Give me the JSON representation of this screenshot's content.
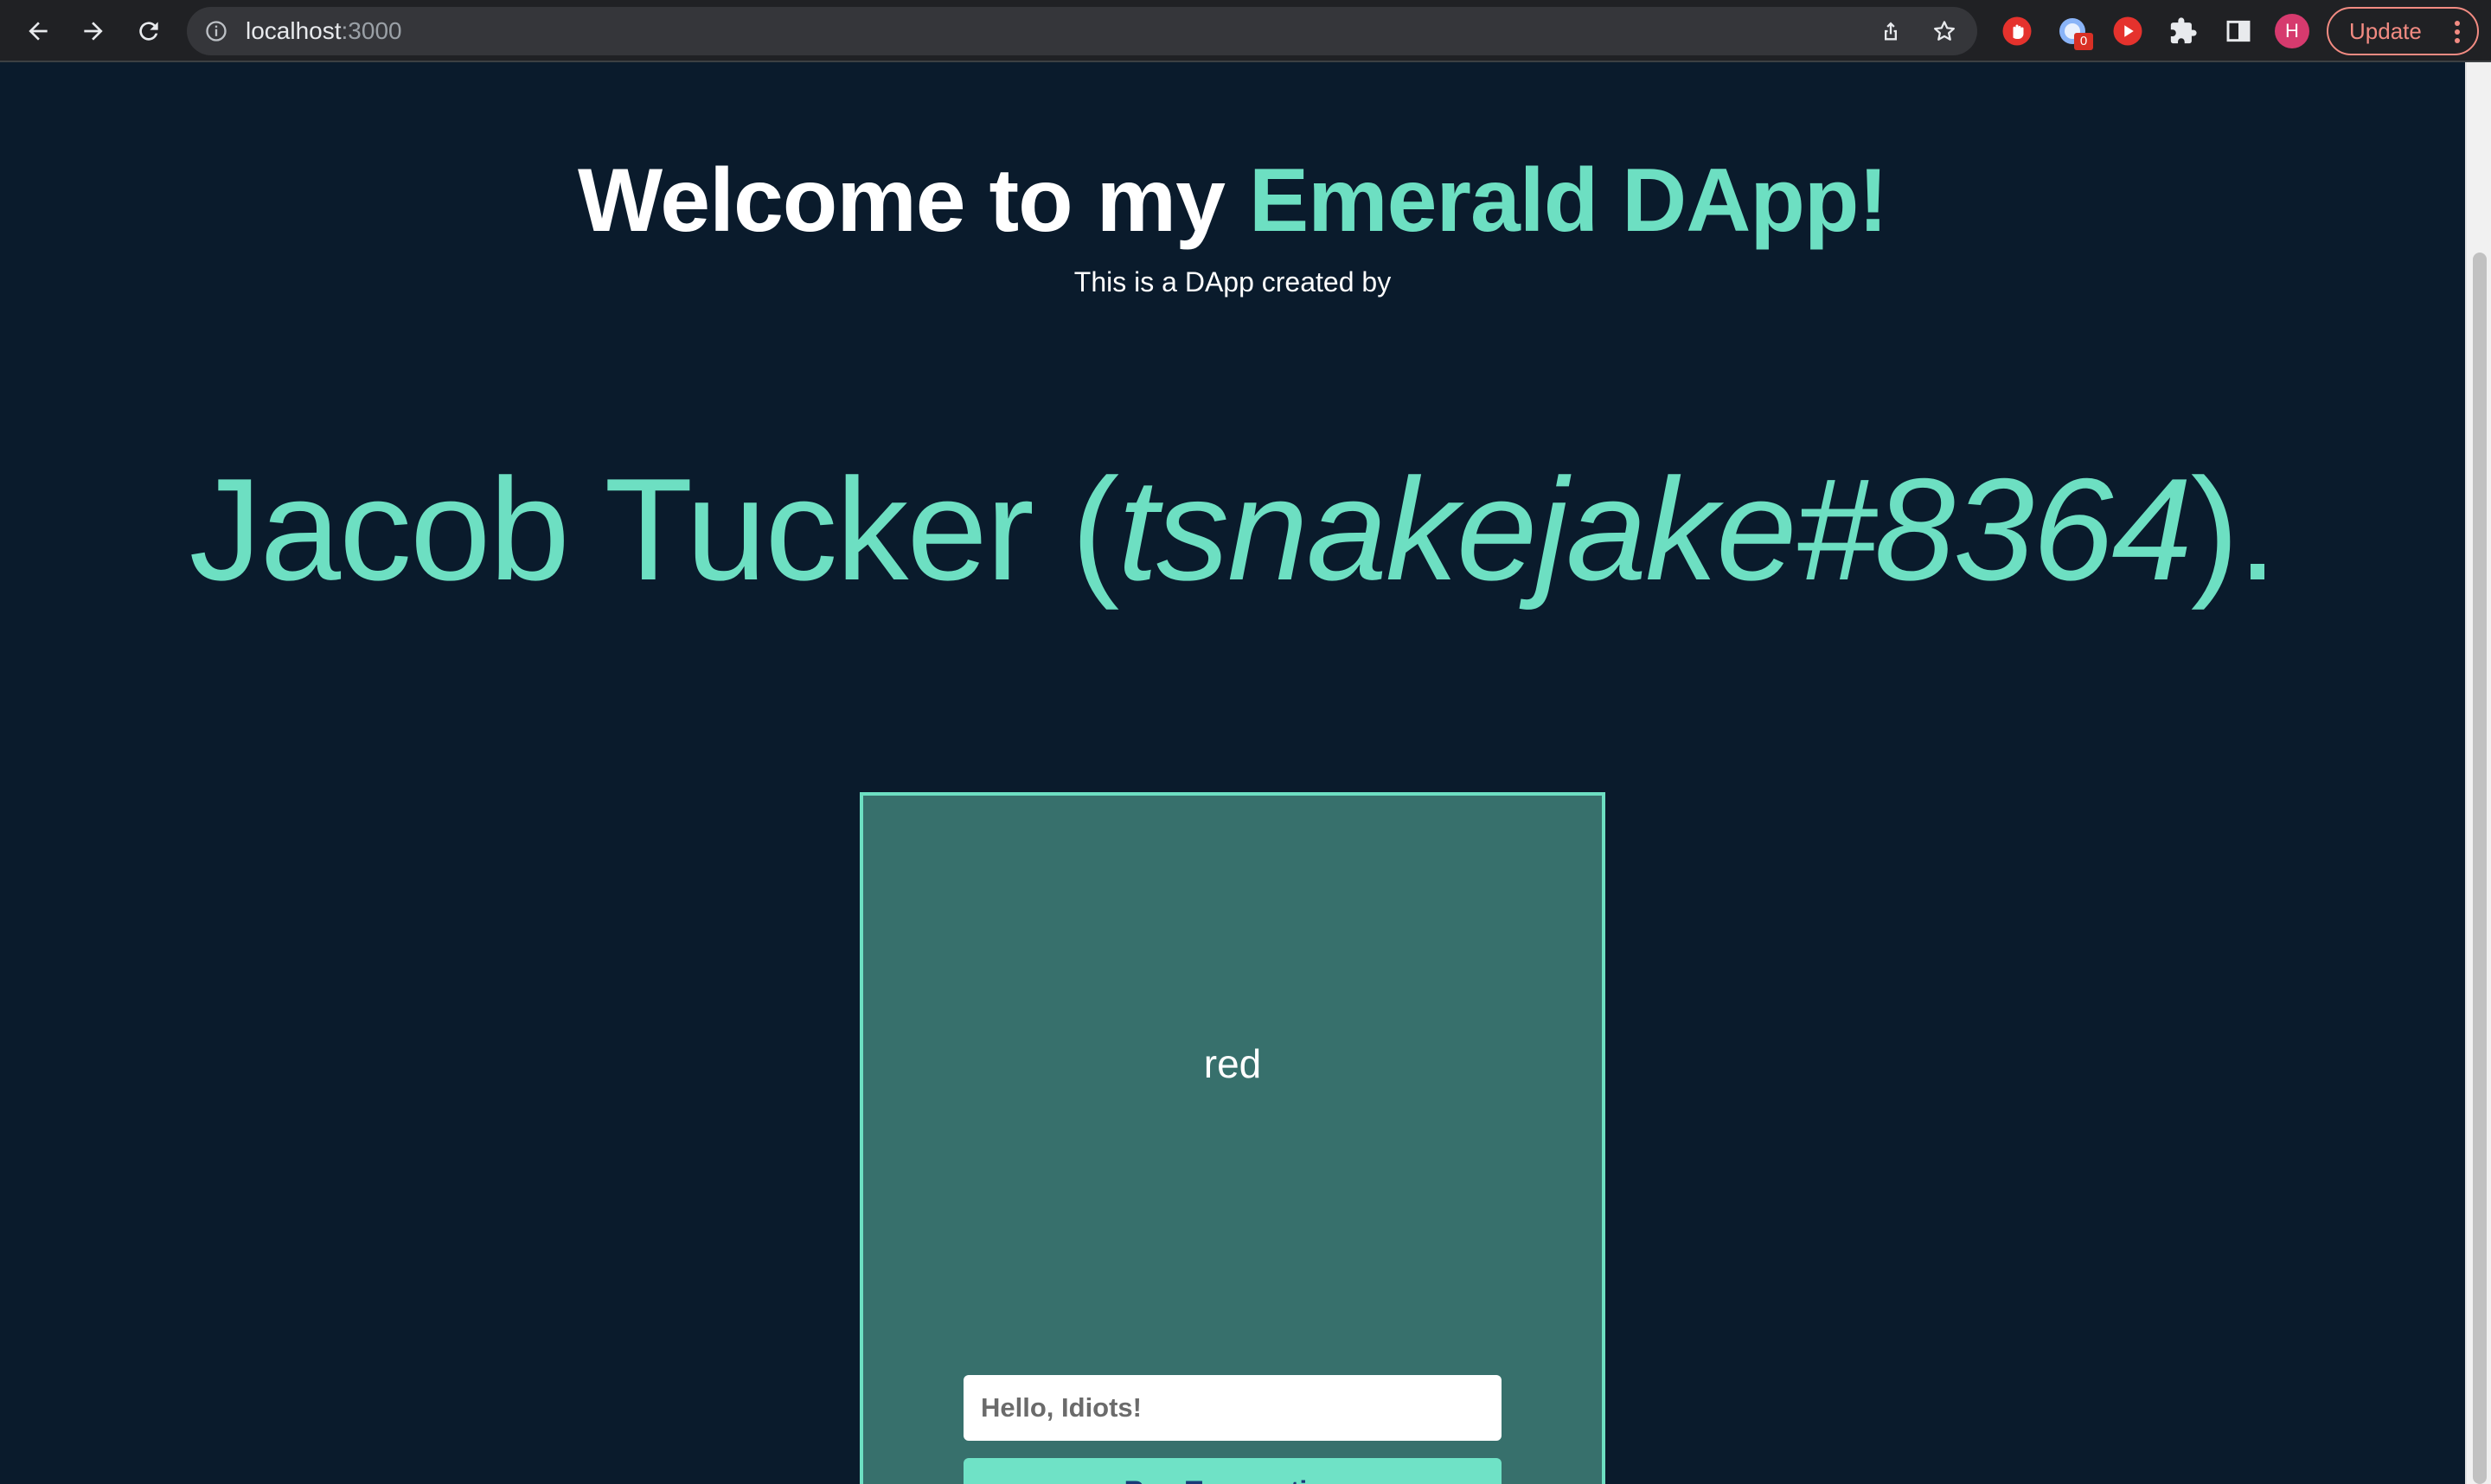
{
  "browser": {
    "url_host": "localhost",
    "url_port": ":3000",
    "update_label": "Update",
    "profile_initial": "H",
    "extension_badge": "0",
    "icons": [
      "back-arrow-icon",
      "forward-arrow-icon",
      "reload-icon",
      "info-icon",
      "share-icon",
      "bookmark-star-icon",
      "extension-hand-icon",
      "extension-globe-icon",
      "extension-play-icon",
      "puzzle-icon",
      "side-panel-icon",
      "kebab-menu-icon"
    ]
  },
  "hero": {
    "title_prefix": "Welcome to my ",
    "title_accent": "Emerald DApp!",
    "subtitle": "This is a DApp created by",
    "author_name": "Jacob Tucker (",
    "author_handle": "tsnakejake#8364",
    "author_suffix": ")."
  },
  "card": {
    "value": "red",
    "input_placeholder": "Hello, Idiots!",
    "button_label": "Run Transaction"
  },
  "colors": {
    "background": "#0a1b2c",
    "accent": "#6ddfc2",
    "card_bg": "#37706c",
    "button_text": "#1a3a78",
    "update_accent": "#f28b82"
  }
}
